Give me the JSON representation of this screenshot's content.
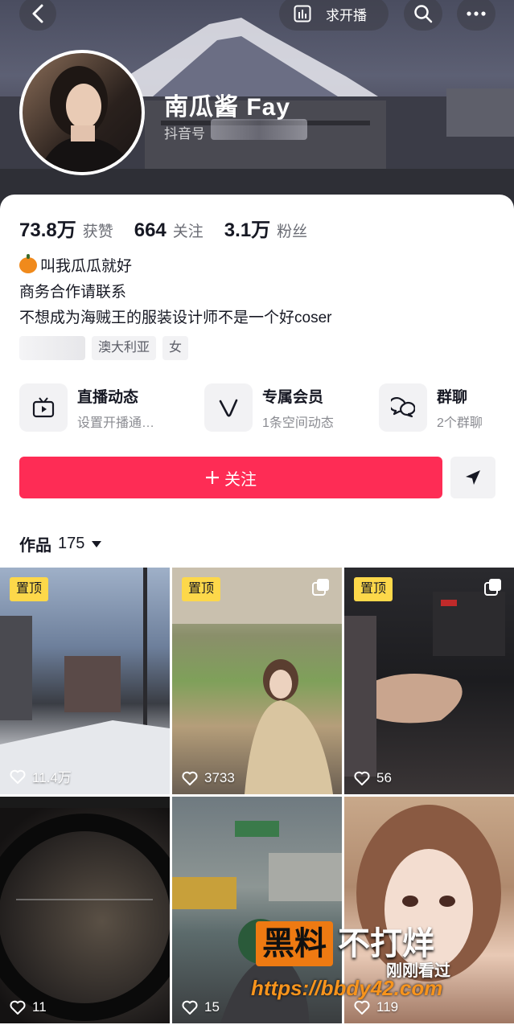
{
  "header": {
    "live_request_label": "求开播",
    "icons": [
      "back-icon",
      "live-stats-icon",
      "search-icon",
      "more-icon"
    ]
  },
  "profile": {
    "nickname": "南瓜酱 Fay",
    "douyin_id_label": "抖音号"
  },
  "stats": [
    {
      "value": "73.8万",
      "label": "获赞"
    },
    {
      "value": "664",
      "label": "关注"
    },
    {
      "value": "3.1万",
      "label": "粉丝"
    }
  ],
  "bio": {
    "line1": "叫我瓜瓜就好",
    "line2": "商务合作请联系",
    "line3": "不想成为海贼王的服装设计师不是一个好coser"
  },
  "tags": [
    "澳大利亚",
    "女"
  ],
  "features": [
    {
      "title": "直播动态",
      "subtitle": "设置开播通…",
      "icon": "tv-icon"
    },
    {
      "title": "专属会员",
      "subtitle": "1条空间动态",
      "icon": "v-icon"
    },
    {
      "title": "群聊",
      "subtitle": "2个群聊",
      "icon": "chat-bubbles-icon"
    }
  ],
  "actions": {
    "follow_label": "关注",
    "follow_color": "#fe2c55"
  },
  "works": {
    "tab_label": "作品",
    "count": "175",
    "pin_label": "置顶",
    "items": [
      {
        "likes": "11.4万",
        "pinned": true,
        "multi": false
      },
      {
        "likes": "3733",
        "pinned": true,
        "multi": true
      },
      {
        "likes": "56",
        "pinned": true,
        "multi": true
      },
      {
        "likes": "11",
        "pinned": false,
        "multi": false
      },
      {
        "likes": "15",
        "pinned": false,
        "multi": false
      },
      {
        "likes": "119",
        "pinned": false,
        "multi": false
      }
    ],
    "overlay_text": "刚刚看过"
  },
  "watermark": {
    "box_text": "黑料",
    "text": "不打烊",
    "url": "https://bbdy42.com"
  }
}
